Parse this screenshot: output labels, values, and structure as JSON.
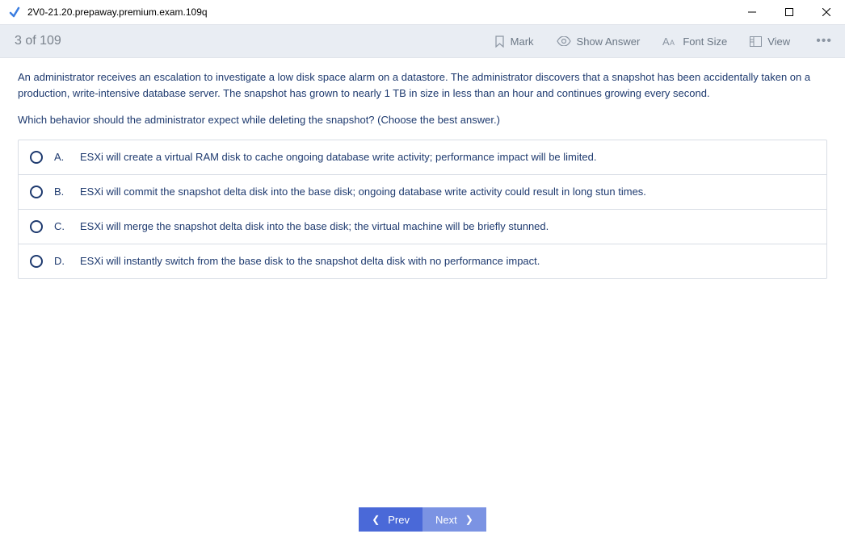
{
  "window": {
    "title": "2V0-21.20.prepaway.premium.exam.109q"
  },
  "toolbar": {
    "counter": "3 of 109",
    "mark": "Mark",
    "show_answer": "Show Answer",
    "font_size": "Font Size",
    "view": "View"
  },
  "question": {
    "paragraph1": "An administrator receives an escalation to investigate a low disk space alarm on a datastore. The administrator discovers that a snapshot has been accidentally taken on a production, write-intensive database server. The snapshot has grown to nearly 1 TB in size in less than an hour and continues growing every second.",
    "paragraph2": "Which behavior should the administrator expect while deleting the snapshot? (Choose the best answer.)"
  },
  "answers": [
    {
      "letter": "A.",
      "text": "ESXi will create a virtual RAM disk to cache ongoing database write activity; performance impact will be limited."
    },
    {
      "letter": "B.",
      "text": "ESXi will commit the snapshot delta disk into the base disk; ongoing database write activity could result in long stun times."
    },
    {
      "letter": "C.",
      "text": "ESXi will merge the snapshot delta disk into the base disk; the virtual machine will be briefly stunned."
    },
    {
      "letter": "D.",
      "text": "ESXi will instantly switch from the base disk to the snapshot delta disk with no performance impact."
    }
  ],
  "nav": {
    "prev": "Prev",
    "next": "Next"
  }
}
